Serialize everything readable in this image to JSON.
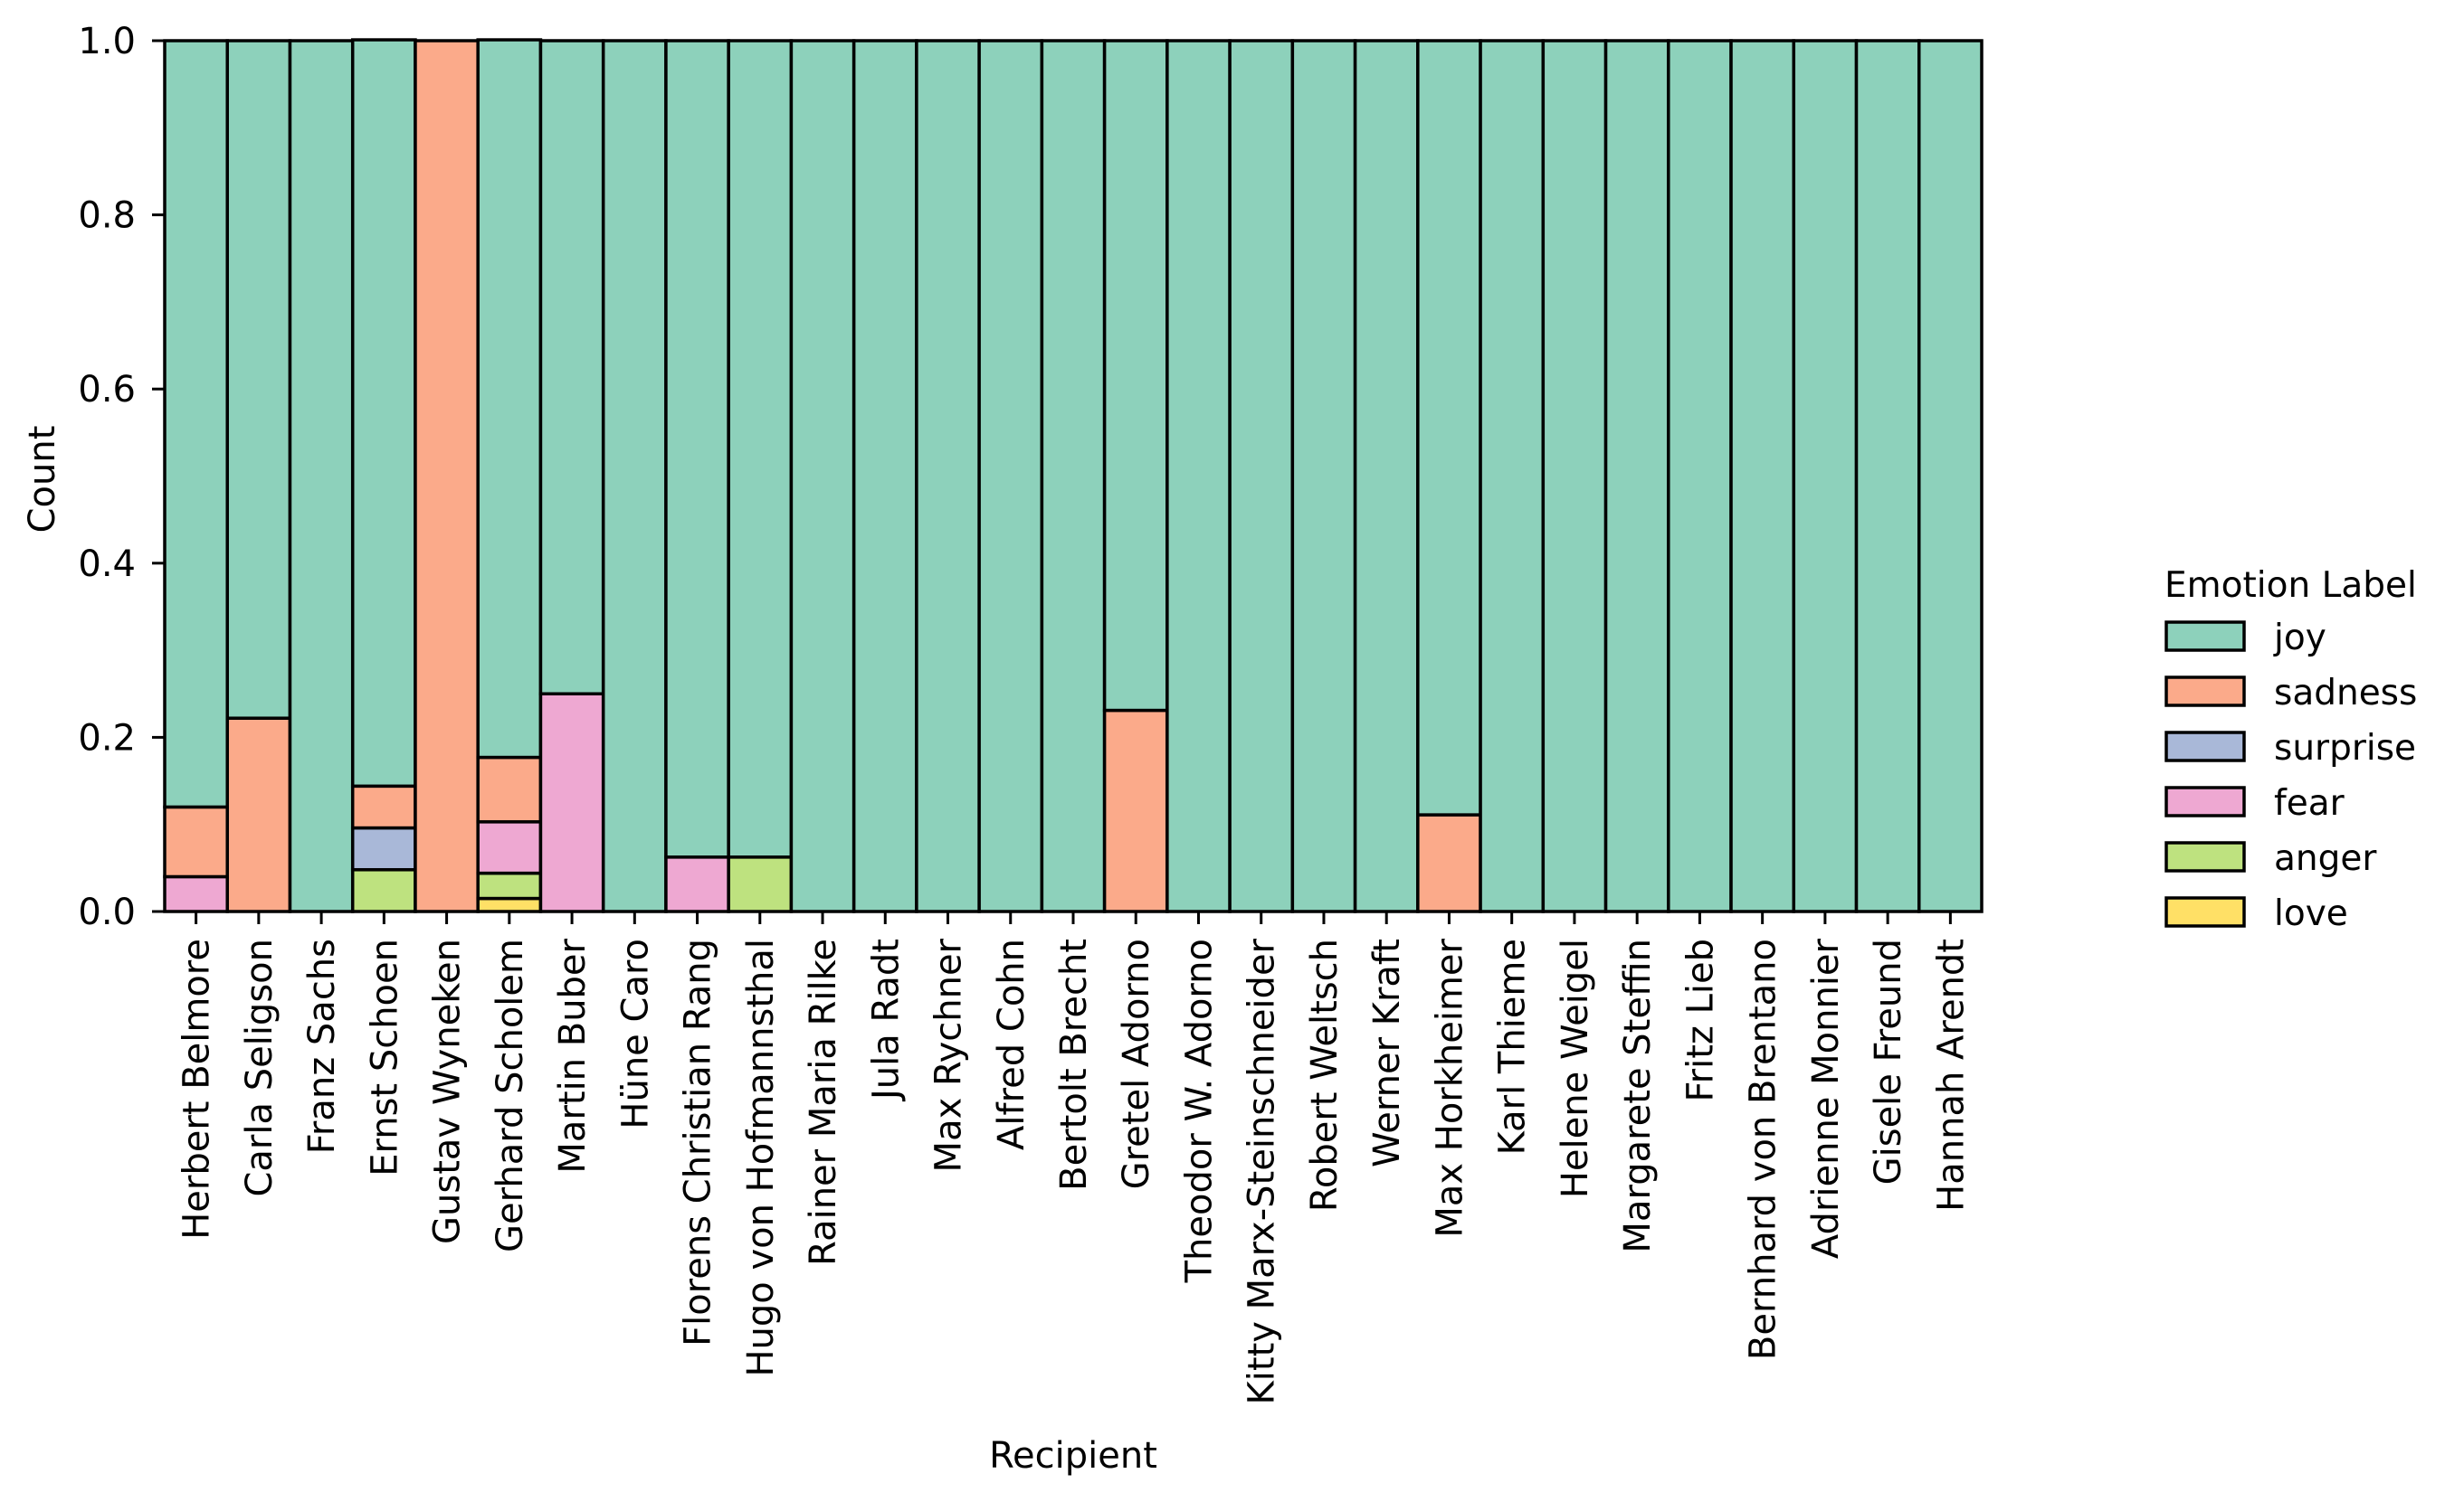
{
  "chart_data": {
    "type": "bar",
    "stacked": true,
    "normalized": true,
    "title": "",
    "xlabel": "Recipient",
    "ylabel": "Count",
    "ylim": [
      0,
      1.0
    ],
    "yticks": [
      "0.0",
      "0.2",
      "0.4",
      "0.6",
      "0.8",
      "1.0"
    ],
    "ytick_values": [
      0,
      0.2,
      0.4,
      0.6,
      0.8,
      1.0
    ],
    "grid": false,
    "legend": {
      "title": "Emotion Label",
      "placement": "right",
      "entries": [
        "joy",
        "sadness",
        "surprise",
        "fear",
        "anger",
        "love"
      ]
    },
    "colors": {
      "joy": "#8dd1bb",
      "sadness": "#fbaa8a",
      "surprise": "#a9b8d8",
      "fear": "#eea8d2",
      "anger": "#bee27f",
      "love": "#ffe066"
    },
    "stack_order_bottom_to_top": [
      "love",
      "anger",
      "fear",
      "surprise",
      "sadness",
      "joy"
    ],
    "categories": [
      "Herbert Belmore",
      "Carla Seligson",
      "Franz Sachs",
      "Ernst Schoen",
      "Gustav Wyneken",
      "Gerhard Scholem",
      "Martin Buber",
      "Hüne Caro",
      "Florens Christian Rang",
      "Hugo von Hofmannsthal",
      "Rainer Maria Rilke",
      "Jula Radt",
      "Max Rychner",
      "Alfred Cohn",
      "Bertolt Brecht",
      "Gretel Adorno",
      "Theodor W. Adorno",
      "Kitty Marx-Steinschneider",
      "Robert Weltsch",
      "Werner Kraft",
      "Max Horkheimer",
      "Karl Thieme",
      "Helene Weigel",
      "Margarete Steffin",
      "Fritz Lieb",
      "Bernhard von Brentano",
      "Adrienne Monnier",
      "Gisele Freund",
      "Hannah Arendt"
    ],
    "series": [
      {
        "name": "joy",
        "values": [
          0.88,
          0.778,
          1.0,
          0.857,
          0.0,
          0.824,
          0.75,
          1.0,
          0.9375,
          0.9375,
          1.0,
          1.0,
          1.0,
          1.0,
          1.0,
          0.769,
          1.0,
          1.0,
          1.0,
          1.0,
          0.889,
          1.0,
          1.0,
          1.0,
          1.0,
          1.0,
          1.0,
          1.0,
          1.0
        ]
      },
      {
        "name": "sadness",
        "values": [
          0.08,
          0.222,
          0.0,
          0.048,
          1.0,
          0.074,
          0.0,
          0.0,
          0.0,
          0.0,
          0.0,
          0.0,
          0.0,
          0.0,
          0.0,
          0.231,
          0.0,
          0.0,
          0.0,
          0.0,
          0.111,
          0.0,
          0.0,
          0.0,
          0.0,
          0.0,
          0.0,
          0.0,
          0.0
        ]
      },
      {
        "name": "surprise",
        "values": [
          0.0,
          0.0,
          0.0,
          0.048,
          0.0,
          0.0,
          0.0,
          0.0,
          0.0,
          0.0,
          0.0,
          0.0,
          0.0,
          0.0,
          0.0,
          0.0,
          0.0,
          0.0,
          0.0,
          0.0,
          0.0,
          0.0,
          0.0,
          0.0,
          0.0,
          0.0,
          0.0,
          0.0,
          0.0
        ]
      },
      {
        "name": "fear",
        "values": [
          0.04,
          0.0,
          0.0,
          0.0,
          0.0,
          0.059,
          0.25,
          0.0,
          0.0625,
          0.0,
          0.0,
          0.0,
          0.0,
          0.0,
          0.0,
          0.0,
          0.0,
          0.0,
          0.0,
          0.0,
          0.0,
          0.0,
          0.0,
          0.0,
          0.0,
          0.0,
          0.0,
          0.0,
          0.0
        ]
      },
      {
        "name": "anger",
        "values": [
          0.0,
          0.0,
          0.0,
          0.048,
          0.0,
          0.029,
          0.0,
          0.0,
          0.0,
          0.0625,
          0.0,
          0.0,
          0.0,
          0.0,
          0.0,
          0.0,
          0.0,
          0.0,
          0.0,
          0.0,
          0.0,
          0.0,
          0.0,
          0.0,
          0.0,
          0.0,
          0.0,
          0.0,
          0.0
        ]
      },
      {
        "name": "love",
        "values": [
          0.0,
          0.0,
          0.0,
          0.0,
          0.0,
          0.015,
          0.0,
          0.0,
          0.0,
          0.0,
          0.0,
          0.0,
          0.0,
          0.0,
          0.0,
          0.0,
          0.0,
          0.0,
          0.0,
          0.0,
          0.0,
          0.0,
          0.0,
          0.0,
          0.0,
          0.0,
          0.0,
          0.0,
          0.0
        ]
      }
    ]
  }
}
